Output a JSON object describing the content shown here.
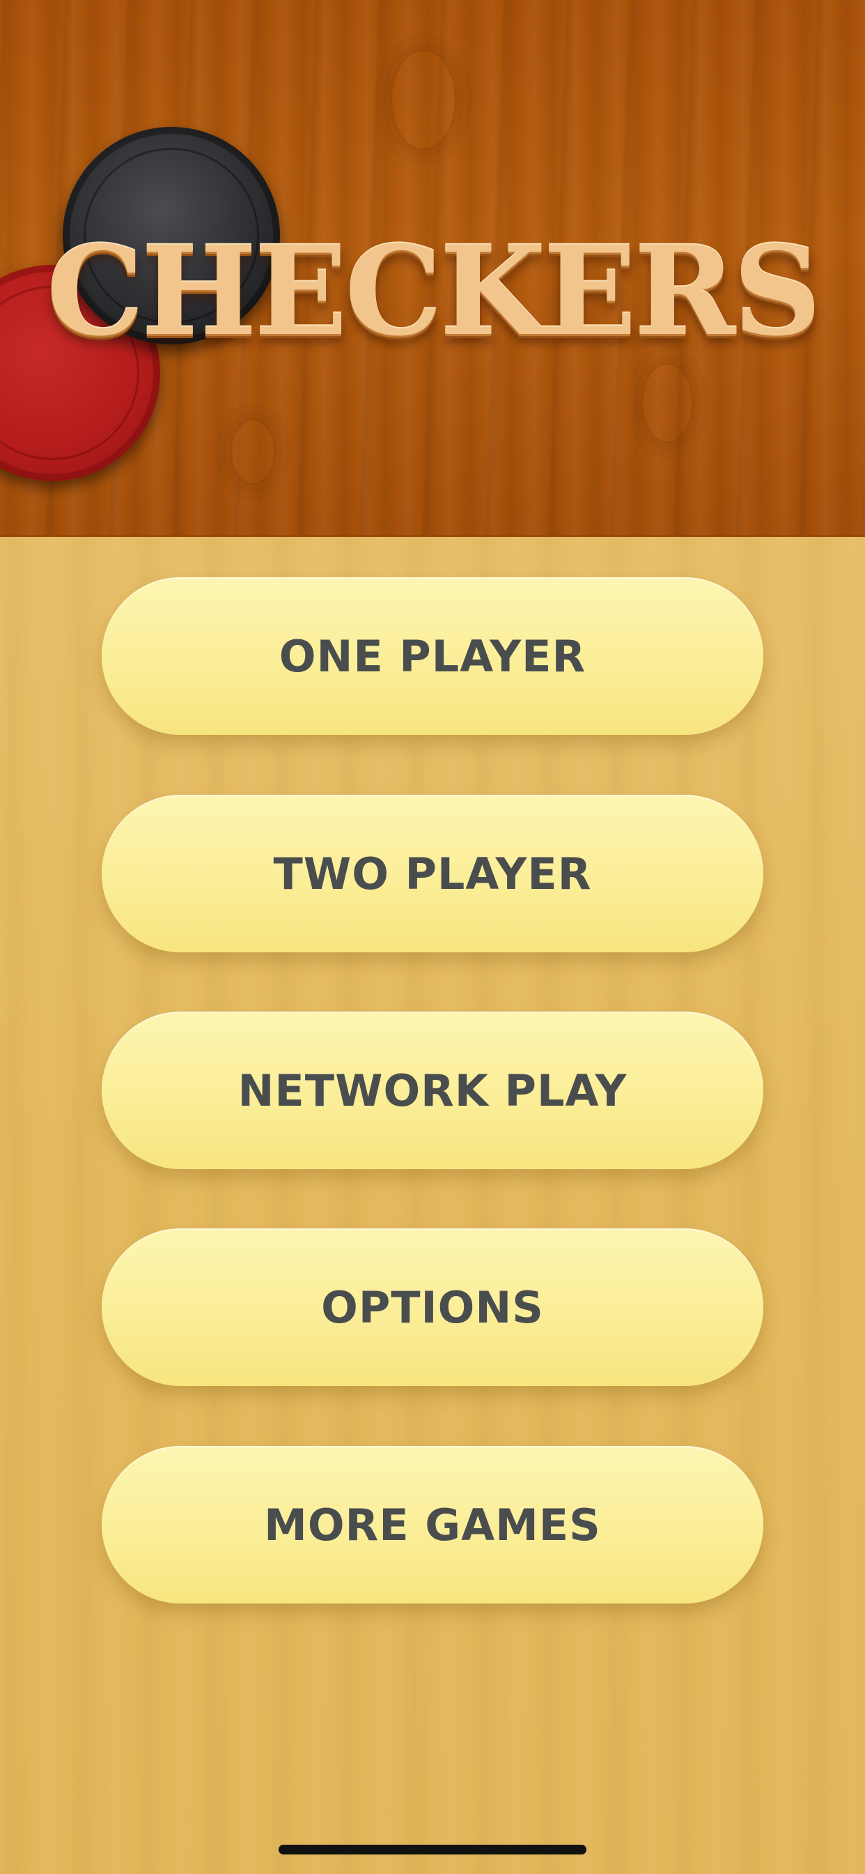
{
  "header": {
    "title": "CHECKERS"
  },
  "menu": {
    "buttons": [
      {
        "label": "ONE PLAYER"
      },
      {
        "label": "TWO PLAYER"
      },
      {
        "label": "NETWORK PLAY"
      },
      {
        "label": "OPTIONS"
      },
      {
        "label": "MORE GAMES"
      }
    ]
  },
  "icons": {
    "red_piece": "red-checker-piece",
    "black_piece": "black-checker-piece"
  },
  "colors": {
    "header_wood": "#a9520a",
    "menu_wood": "#e3b85c",
    "button_fill": "#fbee98",
    "button_text": "#4a4d4e",
    "title_text": "#f2c58c"
  }
}
